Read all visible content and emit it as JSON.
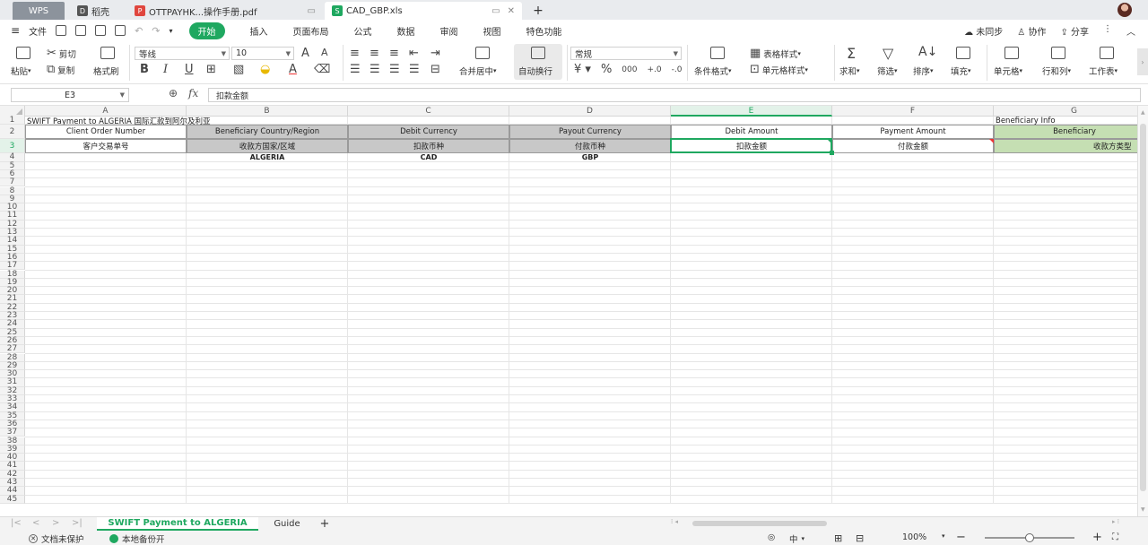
{
  "titlebar": {
    "wps_tab": "WPS",
    "tabs": [
      {
        "label": "稻壳",
        "icon": "daoke-icon"
      },
      {
        "label": "OTTPAYHK...操作手册.pdf",
        "icon": "pdf-icon"
      },
      {
        "label": "CAD_GBP.xls",
        "icon": "spreadsheet-icon"
      }
    ],
    "new_tab": "+"
  },
  "menubar": {
    "file_label": "文件",
    "items": [
      "开始",
      "插入",
      "页面布局",
      "公式",
      "数据",
      "审阅",
      "视图",
      "特色功能"
    ],
    "active": "开始",
    "right": [
      "未同步",
      "协作",
      "分享"
    ]
  },
  "ribbon": {
    "paste": "粘贴",
    "cut": "剪切",
    "copy": "复制",
    "format_painter": "格式刷",
    "font_name": "等线",
    "font_size": "10",
    "merge": "合并居中",
    "wrap": "自动换行",
    "number_format": "常规",
    "conditional": "条件格式",
    "table_style": "表格样式",
    "cell_style": "单元格样式",
    "sum": "求和",
    "filter": "筛选",
    "sort": "排序",
    "fill": "填充",
    "cell": "单元格",
    "rowcol": "行和列",
    "sheet": "工作表"
  },
  "formula": {
    "name_box": "E3",
    "fx": "fx",
    "content": "扣款金额"
  },
  "columns": [
    "A",
    "B",
    "C",
    "D",
    "E",
    "F",
    "G"
  ],
  "selected_column": "E",
  "rows_count": 45,
  "cells": {
    "r1_a": "SWIFT Payment to ALGERIA 国际汇款到阿尔及利亚",
    "r1_g": "Beneficiary Info",
    "r2": [
      "Client Order Number",
      "Beneficiary Country/Region",
      "Debit Currency",
      "Payout Currency",
      "Debit Amount",
      "Payment Amount",
      "Beneficiary"
    ],
    "r3": [
      "客户交易单号",
      "收款方国家/区域",
      "扣款币种",
      "付款币种",
      "扣款金额",
      "付款金额",
      "收款方类型"
    ],
    "r4": [
      "",
      "ALGERIA",
      "CAD",
      "GBP",
      "",
      "",
      ""
    ]
  },
  "sheets": {
    "tabs": [
      "SWIFT Payment to ALGERIA",
      "Guide"
    ],
    "active": "SWIFT Payment to ALGERIA",
    "add": "+"
  },
  "status": {
    "protect": "文档未保护",
    "backup": "本地备份开",
    "zoom": "100%",
    "input_mode": "中"
  },
  "colors": {
    "accent": "#1fa860",
    "header_gray": "#c8c8c8",
    "header_green": "#c5dfb3"
  }
}
